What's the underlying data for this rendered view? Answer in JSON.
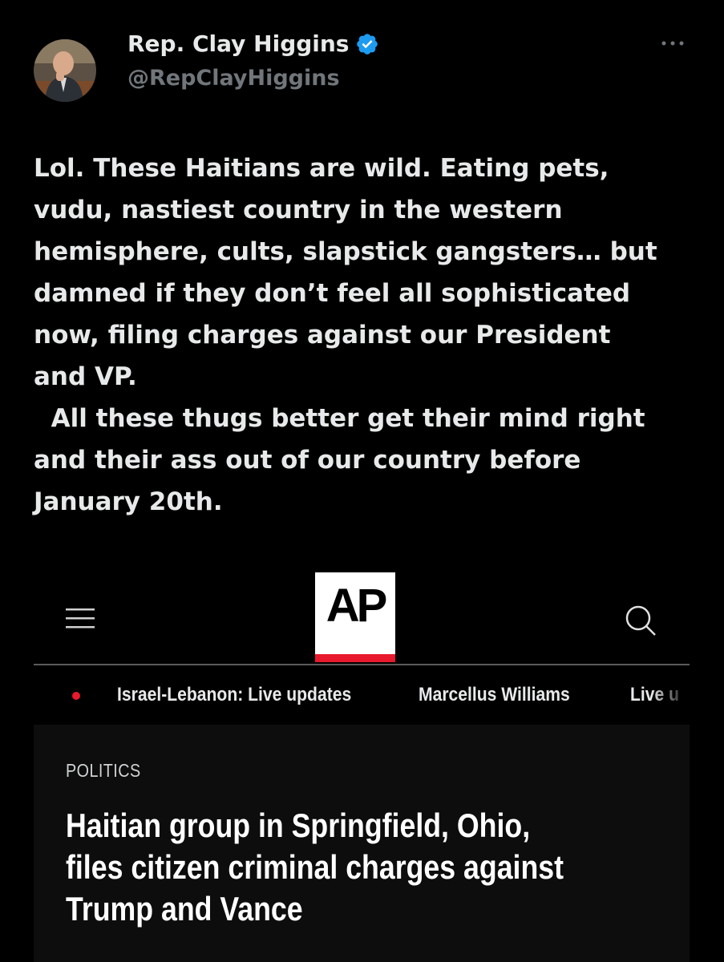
{
  "tweet": {
    "author": {
      "display_name": "Rep. Clay Higgins",
      "handle": "@RepClayHiggins",
      "verified": true,
      "verified_color": "#1d9bf0"
    },
    "more_icon": "ellipsis-icon",
    "text": "Lol. These Haitians are wild. Eating pets,\nvudu, nastiest country in the western\nhemisphere, cults, slapstick gangsters… but\ndamned if they don’t feel all sophisticated\nnow, filing charges against our President\nand VP.\n  All these thugs better get their mind right\nand their ass out of our country before\nJanuary 20th."
  },
  "embed": {
    "nav": {
      "menu_icon": "hamburger-menu-icon",
      "logo_text": "AP",
      "search_icon": "search-icon"
    },
    "trending": {
      "live_dot_color": "#e8192c",
      "items": [
        "Israel-Lebanon: Live updates",
        "Marcellus Williams",
        "Live u"
      ]
    },
    "article": {
      "category": "POLITICS",
      "headline": "Haitian group in Springfield, Ohio,\nfiles citizen criminal charges against\nTrump and Vance"
    }
  },
  "colors": {
    "background": "#000000",
    "text": "#e7e9ea",
    "secondary_text": "#71767b",
    "ap_red": "#e8192c"
  }
}
